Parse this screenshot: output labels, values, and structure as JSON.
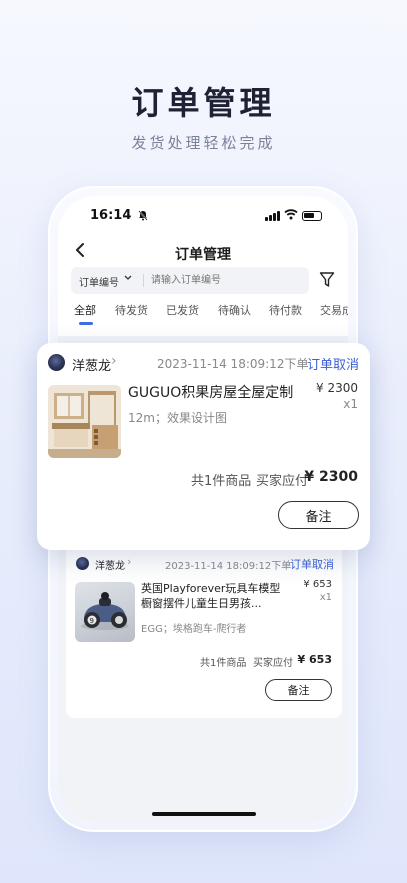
{
  "promo": {
    "headline": "订单管理",
    "subline": "发货处理轻松完成"
  },
  "status_bar": {
    "time": "16:14",
    "bell_icon": "bell-slash-icon"
  },
  "nav": {
    "back_icon": "‹",
    "title": "订单管理"
  },
  "search": {
    "type_label": "订单编号",
    "chevron": "⌄",
    "placeholder": "请输入订单编号"
  },
  "tabs": [
    {
      "label": "全部",
      "active": true
    },
    {
      "label": "待发货"
    },
    {
      "label": "已发货"
    },
    {
      "label": "待确认"
    },
    {
      "label": "待付款"
    },
    {
      "label": "交易成"
    }
  ],
  "orders": [
    {
      "shop": "洋葱龙",
      "chevron": "›",
      "time": "2023-11-14 18:09:12下单",
      "action": "订单取消",
      "product_name": "GUGUO积果房屋全屋定制",
      "spec": "12m；效果设计图",
      "price": "¥ 2300",
      "qty": "x1",
      "count": "共1件商品",
      "pay_label": "买家应付",
      "total": "¥ 2300",
      "note_btn": "备注"
    },
    {
      "shop": "洋葱龙",
      "chevron": "›",
      "time": "2023-11-14 18:09:12下单",
      "action": "订单取消",
      "product_name_line1": "英国Playforever玩具车模型",
      "product_name_line2": "橱窗摆件儿童生日男孩...",
      "spec": "EGG；埃格跑车-爬行者",
      "price": "¥ 653",
      "qty": "x1",
      "count": "共1件商品",
      "pay_label": "买家应付",
      "total": "¥ 653",
      "note_btn": "备注"
    }
  ],
  "colors": {
    "accent": "#3b5fd6",
    "tab_underline": "#3e6de6"
  }
}
